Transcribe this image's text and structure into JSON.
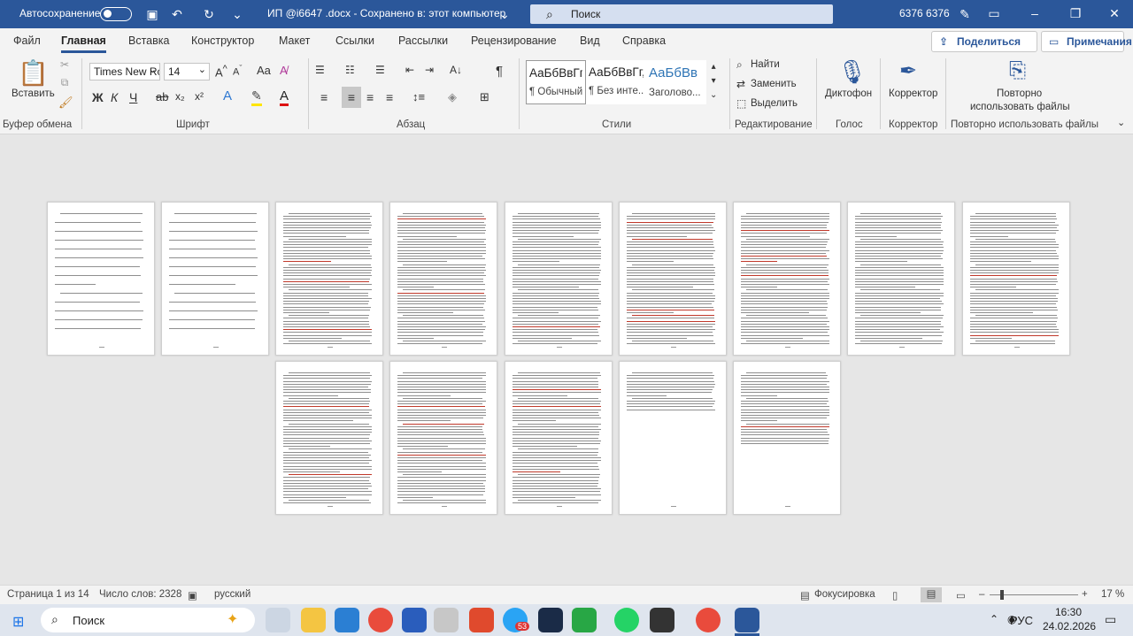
{
  "titlebar": {
    "autosave": "Автосохранение",
    "doc_title": "ИП @i6647 .docx  -  Сохранено в: этот компьютер",
    "search": "Поиск",
    "user": "6376 6376"
  },
  "tabs": [
    "Файл",
    "Главная",
    "Вставка",
    "Конструктор",
    "Макет",
    "Ссылки",
    "Рассылки",
    "Рецензирование",
    "Вид",
    "Справка"
  ],
  "share": "Поделиться",
  "comments": "Примечания",
  "ribbon": {
    "paste": "Вставить",
    "clipboard": "Буфер обмена",
    "font_name": "Times New Rc",
    "font_size": "14",
    "font": "Шрифт",
    "paragraph": "Абзац",
    "styles": [
      {
        "sample": "АаБбВвГг,",
        "name": "¶ Обычный"
      },
      {
        "sample": "АаБбВвГг,",
        "name": "¶ Без инте..."
      },
      {
        "sample": "АаБбВв",
        "name": "Заголово..."
      }
    ],
    "styles_label": "Стили",
    "find": "Найти",
    "replace": "Заменить",
    "select": "Выделить",
    "editing": "Редактирование",
    "dictation": "Диктофон",
    "voice": "Голос",
    "editor": "Корректор",
    "editor_group": "Корректор",
    "reuse": "Повторно\nиспользовать файлы",
    "reuse_l1": "Повторно",
    "reuse_l2": "использовать файлы",
    "reuse_group": "Повторно использовать файлы"
  },
  "status": {
    "page": "Страница 1 из 14",
    "words": "Число слов: 2328",
    "lang": "русский",
    "focus": "Фокусировка",
    "zoom": "17 %"
  },
  "taskbar": {
    "search": "Поиск",
    "lang": "РУС",
    "time": "16:30",
    "date": "24.02.2026",
    "badge": "53"
  }
}
